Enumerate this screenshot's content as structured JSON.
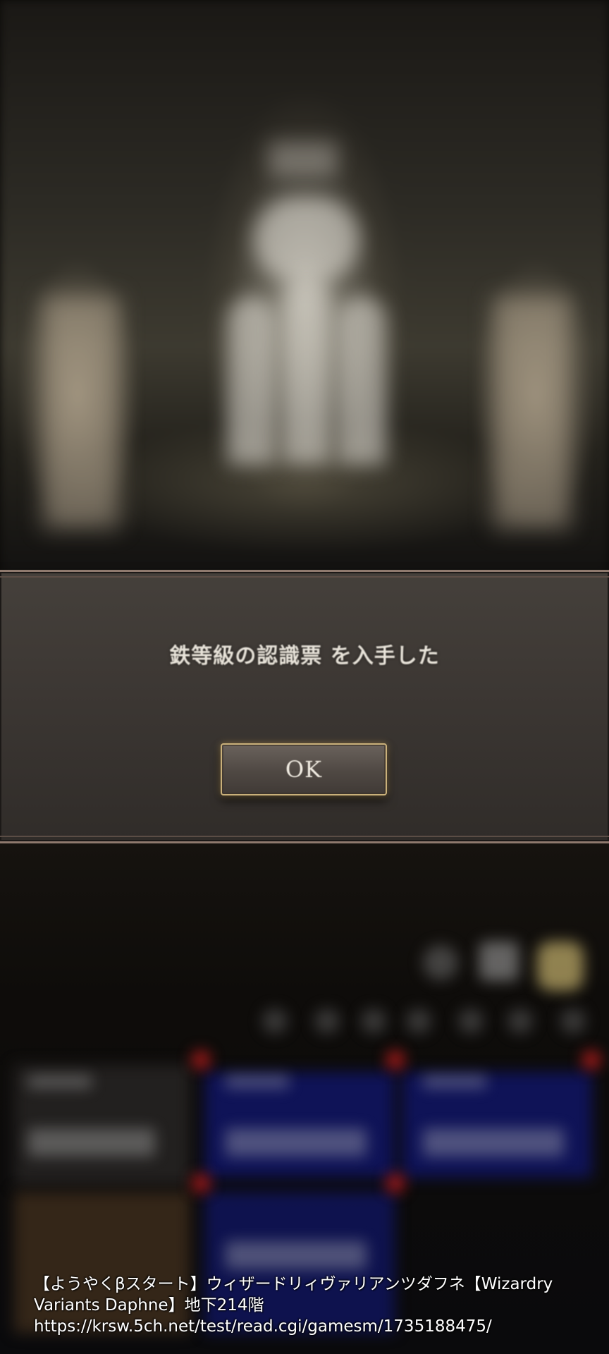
{
  "dialog": {
    "message": "鉄等級の認識票 を入手した",
    "ok_label": "OK"
  },
  "caption": {
    "line1": "【ようやくβスタート】ウィザードリィヴァリアンツダフネ【Wizardry",
    "line2": "Variants Daphne】地下214階",
    "line3": "https://krsw.5ch.net/test/read.cgi/gamesm/1735188475/"
  },
  "colors": {
    "dialog_border": "#8f7a6e",
    "button_border": "#c9b07a",
    "party_panel_blue": "#0f145f"
  }
}
